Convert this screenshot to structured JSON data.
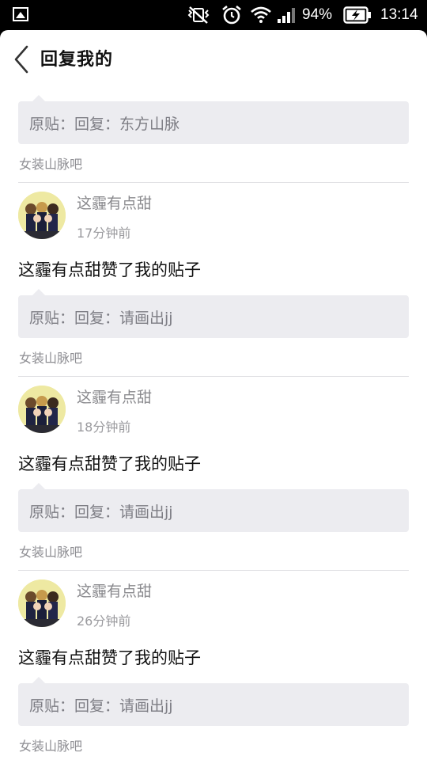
{
  "status_bar": {
    "battery": "94%",
    "time": "13:14"
  },
  "header": {
    "title": "回复我的"
  },
  "items": [
    {
      "quote": "原贴：回复：东方山脉",
      "forum": "女装山脉吧"
    },
    {
      "username": "这霾有点甜",
      "time": "17分钟前",
      "content": "这霾有点甜赞了我的贴子",
      "quote": "原贴：回复：请画出jj",
      "forum": "女装山脉吧"
    },
    {
      "username": "这霾有点甜",
      "time": "18分钟前",
      "content": "这霾有点甜赞了我的贴子",
      "quote": "原贴：回复：请画出jj",
      "forum": "女装山脉吧"
    },
    {
      "username": "这霾有点甜",
      "time": "26分钟前",
      "content": "这霾有点甜赞了我的贴子",
      "quote": "原贴：回复：请画出jj",
      "forum": "女装山脉吧"
    }
  ]
}
